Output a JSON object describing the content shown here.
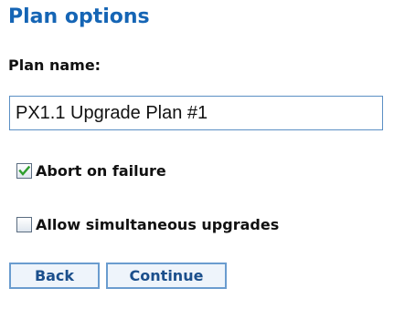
{
  "page": {
    "title": "Plan options"
  },
  "form": {
    "plan_name_label": "Plan name:",
    "plan_name_value": "PX1.1 Upgrade Plan #1",
    "abort_on_failure": {
      "label": "Abort on failure",
      "checked": true
    },
    "allow_simultaneous": {
      "label": "Allow simultaneous upgrades",
      "checked": false
    }
  },
  "buttons": {
    "back_label": "Back",
    "continue_label": "Continue"
  },
  "colors": {
    "title": "#1565b5",
    "button_text": "#1b4f8c",
    "button_border": "#6a9ccf",
    "checkmark": "#2e9e2e"
  }
}
